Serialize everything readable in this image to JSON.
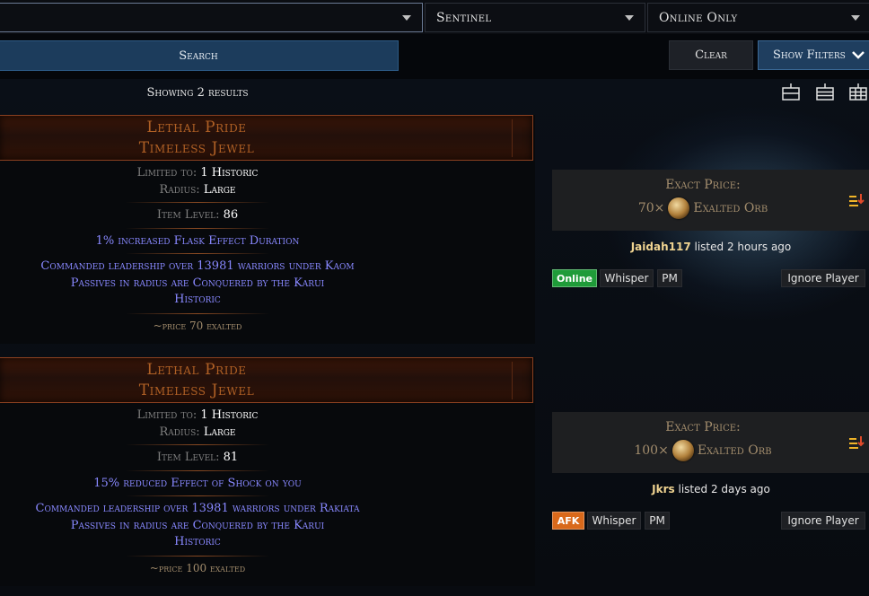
{
  "filters": {
    "item_select_value": "",
    "league": "Sentinel",
    "status": "Online Only"
  },
  "actions": {
    "search": "Search",
    "clear": "Clear",
    "show_filters": "Show Filters"
  },
  "results": {
    "summary": "Showing 2 results",
    "items": [
      {
        "name": "Lethal Pride",
        "base": "Timeless Jewel",
        "limited_label": "Limited to:",
        "limited_value": "1 Historic",
        "radius_label": "Radius:",
        "radius_value": "Large",
        "ilvl_label": "Item Level:",
        "ilvl_value": "86",
        "implicit": "1% increased Flask Effect Duration",
        "mod1": "Commanded leadership over 13981 warriors under Kaom",
        "mod2": "Passives in radius are Conquered by the Karui",
        "mod3": "Historic",
        "note": "~price 70 exalted",
        "price_title": "Exact Price:",
        "price_amount": "70×",
        "currency": "Exalted Orb",
        "seller": "Jaidah117",
        "listed": "listed 2 hours ago",
        "status": "Online",
        "status_color": "#1f9b39",
        "whisper": "Whisper",
        "pm": "PM",
        "ignore": "Ignore Player"
      },
      {
        "name": "Lethal Pride",
        "base": "Timeless Jewel",
        "limited_label": "Limited to:",
        "limited_value": "1 Historic",
        "radius_label": "Radius:",
        "radius_value": "Large",
        "ilvl_label": "Item Level:",
        "ilvl_value": "81",
        "implicit": "15% reduced Effect of Shock on you",
        "mod1": "Commanded leadership over 13981 warriors under Rakiata",
        "mod2": "Passives in radius are Conquered by the Karui",
        "mod3": "Historic",
        "note": "~price 100 exalted",
        "price_title": "Exact Price:",
        "price_amount": "100×",
        "currency": "Exalted Orb",
        "seller": "Jkrs",
        "listed": "listed 2 days ago",
        "status": "AFK",
        "status_color": "#d9691b",
        "whisper": "Whisper",
        "pm": "PM",
        "ignore": "Ignore Player"
      }
    ]
  },
  "icons": {
    "view_list": "list-view-icon",
    "view_compact": "compact-view-icon",
    "view_grid": "grid-view-icon",
    "currency": "exalted-orb-icon",
    "sort": "sort-icon"
  },
  "colors": {
    "unique_item": "#af6025",
    "magic_mod": "#8888ff",
    "price_text": "#a38d6d",
    "accent_blue": "#1f3e5f"
  }
}
